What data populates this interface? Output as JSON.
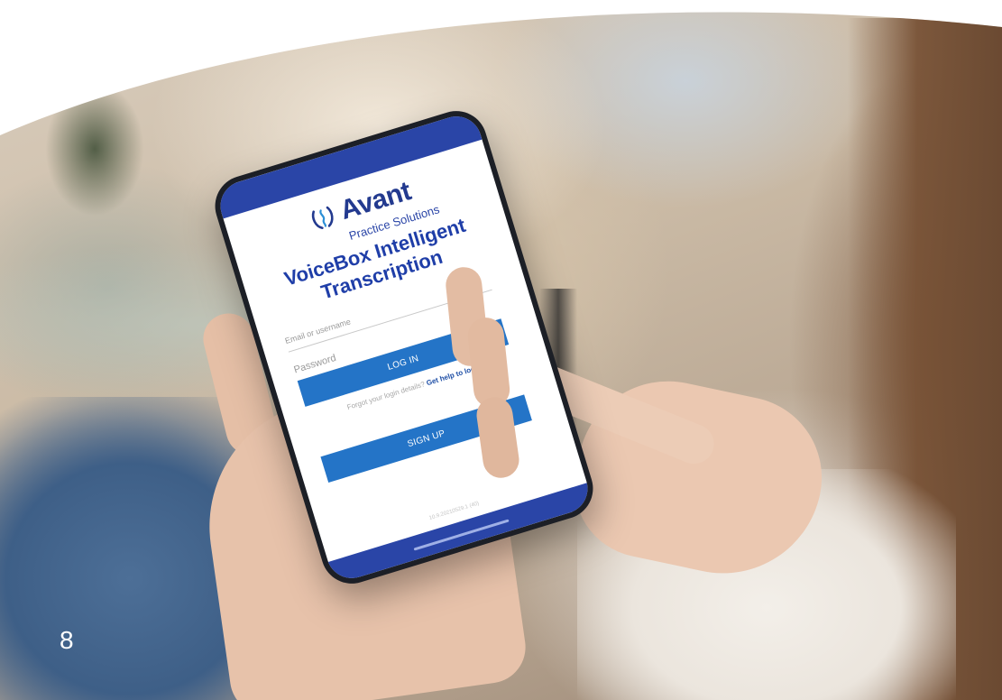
{
  "app": {
    "logo_name": "Avant",
    "logo_sub": "Practice Solutions",
    "title": "VoiceBox Intelligent Transcription",
    "email_placeholder": "Email or username",
    "password_placeholder": "Password",
    "login_label": "LOG IN",
    "help_text": "Forgot your login details?",
    "help_link": "Get help to log in.",
    "signup_label": "SIGN UP",
    "version": "10.9.20210529.1 (40)"
  },
  "page": {
    "number": "8"
  },
  "colors": {
    "brand_navy": "#233a8f",
    "brand_blue": "#2a45a7",
    "button_blue": "#2474c7"
  },
  "icons": {
    "logo": "avant-logo-icon"
  }
}
